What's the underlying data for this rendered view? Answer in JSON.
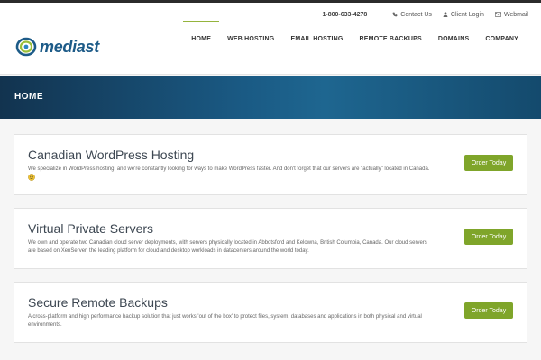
{
  "topbar": {
    "phone": "1-800-633-4278",
    "links": [
      {
        "label": "Contact Us",
        "icon": "phone-icon"
      },
      {
        "label": "Client Login",
        "icon": "user-icon"
      },
      {
        "label": "Webmail",
        "icon": "mail-icon"
      }
    ]
  },
  "logo": {
    "text": "mediast"
  },
  "nav": {
    "items": [
      "HOME",
      "WEB HOSTING",
      "EMAIL HOSTING",
      "REMOTE BACKUPS",
      "DOMAINS",
      "COMPANY"
    ],
    "active": "HOME"
  },
  "banner": {
    "title": "HOME"
  },
  "cards": [
    {
      "title": "Canadian WordPress Hosting",
      "desc": "We specialize in WordPress hosting, and we're constantly looking for ways to make WordPress faster. And don't forget that our servers are \"actually\" located in Canada.",
      "button": "Order Today"
    },
    {
      "title": "Virtual Private Servers",
      "desc": "We own and operate two Canadian cloud server deployments, with servers physically located in Abbotsford and Kelowna, British Columbia, Canada. Our cloud servers are based on XenServer, the leading platform for cloud and desktop workloads in datacenters around the world today.",
      "button": "Order Today"
    },
    {
      "title": "Secure Remote Backups",
      "desc": "A cross-platform and high performance backup solution that just works 'out of the box' to protect files, system, databases and applications in both physical and virtual environments.",
      "button": "Order Today"
    }
  ],
  "colors": {
    "accent_green": "#7fa52a",
    "banner_blue": "#1a5a84",
    "logo_blue": "#1d5b88"
  }
}
